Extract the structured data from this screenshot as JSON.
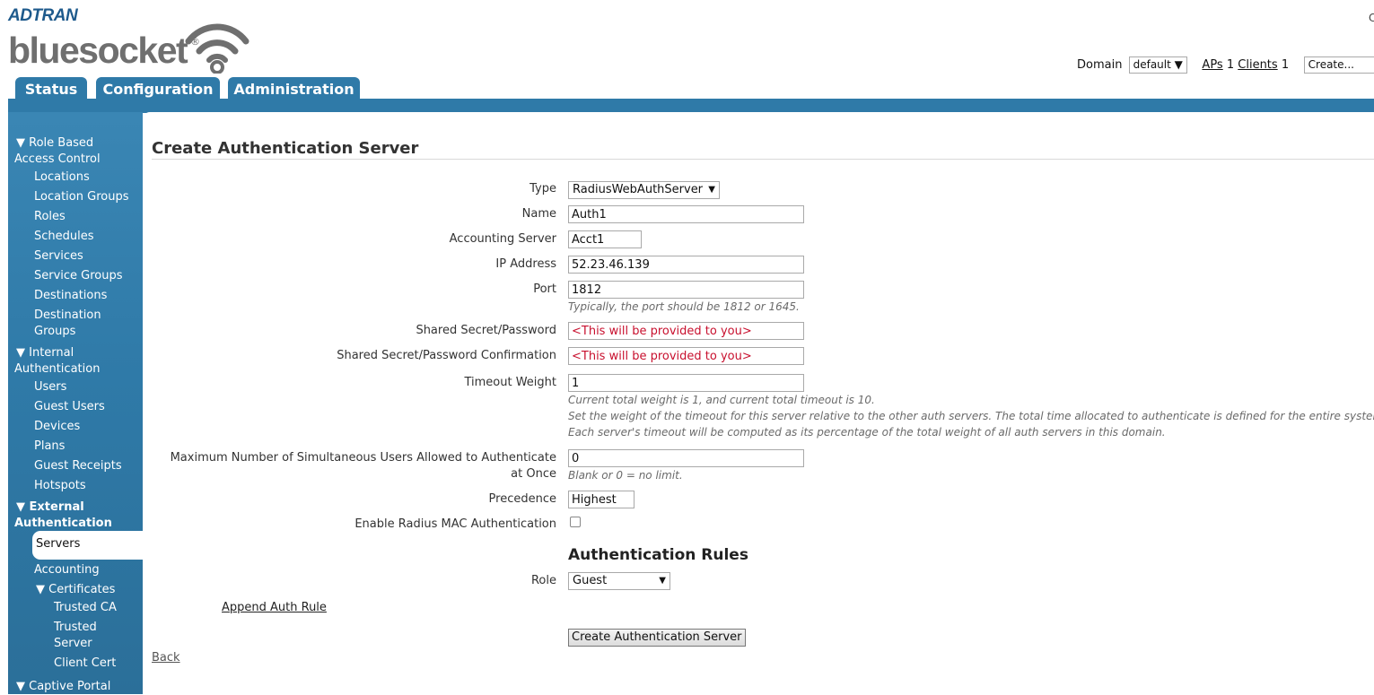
{
  "brand": {
    "company": "ADTRAN",
    "product": "bluesocket",
    "reg": "®"
  },
  "topbar": {
    "domain_label": "Domain",
    "domain_value": "default",
    "aps_label": "APs",
    "aps_count": "1",
    "clients_label": "Clients",
    "clients_count": "1",
    "create_placeholder": "Create...",
    "edge_char": "C"
  },
  "tabs": [
    {
      "label": "Status"
    },
    {
      "label": "Configuration"
    },
    {
      "label": "Administration"
    }
  ],
  "sidebar": {
    "rbac": "▼ Role Based",
    "rbac2": "Access Control",
    "items": [
      "Locations",
      "Location Groups",
      "Roles",
      "Schedules",
      "Services",
      "Service Groups",
      "Destinations",
      "Destination",
      "Groups"
    ],
    "internal": "▼ Internal",
    "internal2": "Authentication",
    "internal_items": [
      "Users",
      "Guest Users",
      "Devices",
      "Plans",
      "Guest Receipts",
      "Hotspots"
    ],
    "external": "▼ External",
    "external2": "Authentication",
    "active": "Servers",
    "accounting": "Accounting",
    "certificates": "▼ Certificates",
    "cert_items": [
      "Trusted CA",
      "Trusted",
      "Server",
      "Client Cert"
    ],
    "captive": "▼ Captive Portal"
  },
  "form": {
    "title": "Create Authentication Server",
    "type_label": "Type",
    "type_value": "RadiusWebAuthServer",
    "name_label": "Name",
    "name_value": "Auth1",
    "acct_label": "Accounting Server",
    "acct_value": "Acct1",
    "ip_label": "IP Address",
    "ip_value": "52.23.46.139",
    "port_label": "Port",
    "port_value": "1812",
    "port_hint": "Typically, the port should be 1812 or 1645.",
    "secret_label": "Shared Secret/Password",
    "secret_value": "<This will be provided to you>",
    "secret_confirm_label": "Shared Secret/Password Confirmation",
    "secret_confirm_value": "<This will be provided to you>",
    "timeout_label": "Timeout Weight",
    "timeout_value": "1",
    "timeout_hint1": "Current total weight is 1, and current total timeout is 10.",
    "timeout_hint2": "Set the weight of the timeout for this server relative to the other auth servers. The total time allocated to authenticate is defined for the entire system.",
    "timeout_hint3": "Each server's timeout will be computed as its percentage of the total weight of all auth servers in this domain.",
    "max_label1": "Maximum Number of Simultaneous Users Allowed to Authenticate",
    "max_label2": "at Once",
    "max_value": "0",
    "max_hint": "Blank or 0 = no limit.",
    "prec_label": "Precedence",
    "prec_value": "Highest",
    "mac_label": "Enable Radius MAC Authentication",
    "rules_heading": "Authentication Rules",
    "role_label": "Role",
    "role_value": "Guest",
    "append_label": "Append Auth Rule",
    "submit_label": "Create Authentication Server",
    "back_label": "Back"
  },
  "colors": {
    "nav_blue": "#2f7aa8",
    "secret_red": "#c8102e"
  }
}
